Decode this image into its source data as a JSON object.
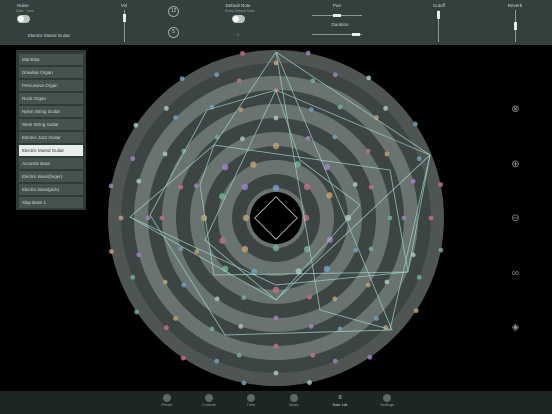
{
  "header": {
    "noise": {
      "label": "Noise",
      "tiny": "Dark · Tone"
    },
    "vol": {
      "label": "Vol"
    },
    "knob_top": "12",
    "knob_bottom": "5",
    "default_note": {
      "label": "Default Note",
      "tiny": "Every Default Note",
      "value": "D"
    },
    "pan": {
      "label": "Pan"
    },
    "duration": {
      "label": "Duration"
    },
    "cutoff": {
      "label": "Cutoff"
    },
    "reverb": {
      "label": "Reverb"
    },
    "instrument_selected": "Electric Muted Guitar"
  },
  "instruments": [
    "Marimba",
    "Drawbar Organ",
    "Percussive Organ",
    "Rock Organ",
    "Nylon String Guitar",
    "Steel String Guitar",
    "Electric Jazz Guitar",
    "Electric Muted Guitar",
    "Acoustic Bass",
    "Electric Bass(finger)",
    "Electric Bass(pick)",
    "Slap Bass 1"
  ],
  "selected_index": 7,
  "side_icons": [
    "close-icon",
    "zoom-in-icon",
    "zoom-out-icon",
    "link-icon",
    "metronome-icon"
  ],
  "tabs": [
    {
      "label": "Preset",
      "icon": "preset-icon"
    },
    {
      "label": "Controls",
      "icon": "controls-icon"
    },
    {
      "label": "Tutor",
      "icon": "tutor-icon"
    },
    {
      "label": "Music",
      "icon": "music-icon"
    },
    {
      "label": "Note List",
      "icon": "note-list-icon"
    },
    {
      "label": "Settings",
      "icon": "settings-icon"
    }
  ],
  "active_tab": 4,
  "colors": {
    "bg": "#000000",
    "topbar": "#33403e",
    "ring_light": "#8e9a98",
    "ring_dark": "#3c4544",
    "accent": "#9fd4c8"
  }
}
